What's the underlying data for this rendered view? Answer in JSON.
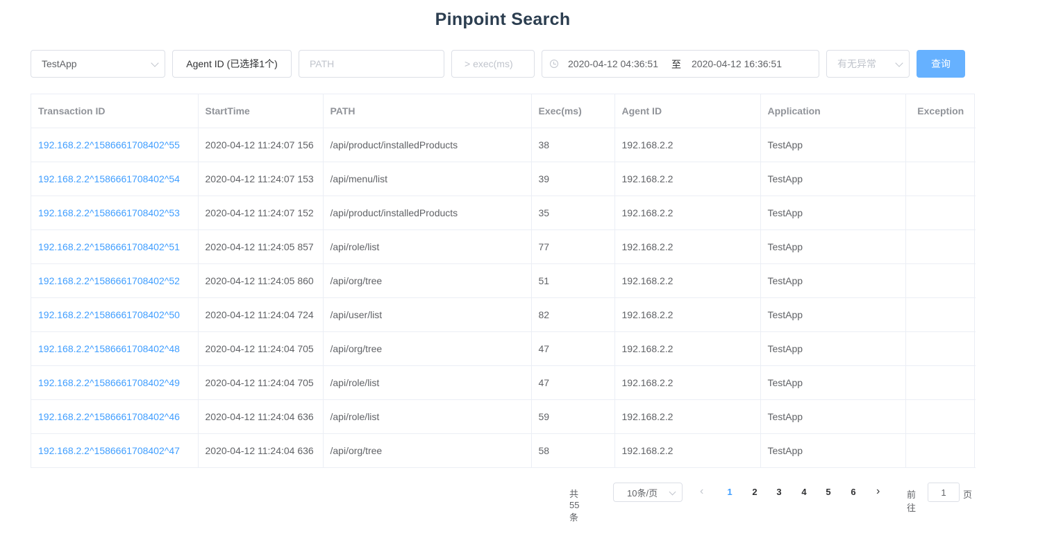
{
  "title": "Pinpoint Search",
  "filters": {
    "application": "TestApp",
    "agent_button": "Agent ID (已选择1个)",
    "path_placeholder": "PATH",
    "exec_placeholder": "> exec(ms)",
    "date_start": "2020-04-12 04:36:51",
    "date_separator": "至",
    "date_end": "2020-04-12 16:36:51",
    "exception_placeholder": "有无异常",
    "query_button": "查询"
  },
  "table": {
    "columns": [
      "Transaction ID",
      "StartTime",
      "PATH",
      "Exec(ms)",
      "Agent ID",
      "Application",
      "Exception"
    ],
    "rows": [
      {
        "tx": "192.168.2.2^1586661708402^55",
        "start": "2020-04-12 11:24:07 156",
        "path": "/api/product/installedProducts",
        "exec": "38",
        "agent": "192.168.2.2",
        "app": "TestApp",
        "exception": ""
      },
      {
        "tx": "192.168.2.2^1586661708402^54",
        "start": "2020-04-12 11:24:07 153",
        "path": "/api/menu/list",
        "exec": "39",
        "agent": "192.168.2.2",
        "app": "TestApp",
        "exception": ""
      },
      {
        "tx": "192.168.2.2^1586661708402^53",
        "start": "2020-04-12 11:24:07 152",
        "path": "/api/product/installedProducts",
        "exec": "35",
        "agent": "192.168.2.2",
        "app": "TestApp",
        "exception": ""
      },
      {
        "tx": "192.168.2.2^1586661708402^51",
        "start": "2020-04-12 11:24:05 857",
        "path": "/api/role/list",
        "exec": "77",
        "agent": "192.168.2.2",
        "app": "TestApp",
        "exception": ""
      },
      {
        "tx": "192.168.2.2^1586661708402^52",
        "start": "2020-04-12 11:24:05 860",
        "path": "/api/org/tree",
        "exec": "51",
        "agent": "192.168.2.2",
        "app": "TestApp",
        "exception": ""
      },
      {
        "tx": "192.168.2.2^1586661708402^50",
        "start": "2020-04-12 11:24:04 724",
        "path": "/api/user/list",
        "exec": "82",
        "agent": "192.168.2.2",
        "app": "TestApp",
        "exception": ""
      },
      {
        "tx": "192.168.2.2^1586661708402^48",
        "start": "2020-04-12 11:24:04 705",
        "path": "/api/org/tree",
        "exec": "47",
        "agent": "192.168.2.2",
        "app": "TestApp",
        "exception": ""
      },
      {
        "tx": "192.168.2.2^1586661708402^49",
        "start": "2020-04-12 11:24:04 705",
        "path": "/api/role/list",
        "exec": "47",
        "agent": "192.168.2.2",
        "app": "TestApp",
        "exception": ""
      },
      {
        "tx": "192.168.2.2^1586661708402^46",
        "start": "2020-04-12 11:24:04 636",
        "path": "/api/role/list",
        "exec": "59",
        "agent": "192.168.2.2",
        "app": "TestApp",
        "exception": ""
      },
      {
        "tx": "192.168.2.2^1586661708402^47",
        "start": "2020-04-12 11:24:04 636",
        "path": "/api/org/tree",
        "exec": "58",
        "agent": "192.168.2.2",
        "app": "TestApp",
        "exception": ""
      }
    ]
  },
  "pagination": {
    "total": "共 55 条",
    "page_size": "10条/页",
    "pages": [
      "1",
      "2",
      "3",
      "4",
      "5",
      "6"
    ],
    "current": "1",
    "goto_label": "前往",
    "goto_value": "1",
    "page_suffix": "页",
    "prev_icon": "chevron-left-icon",
    "next_icon": "chevron-right-icon"
  },
  "colors": {
    "link": "#409eff",
    "primary_button": "#66b1ff",
    "title": "#2c3e50"
  }
}
